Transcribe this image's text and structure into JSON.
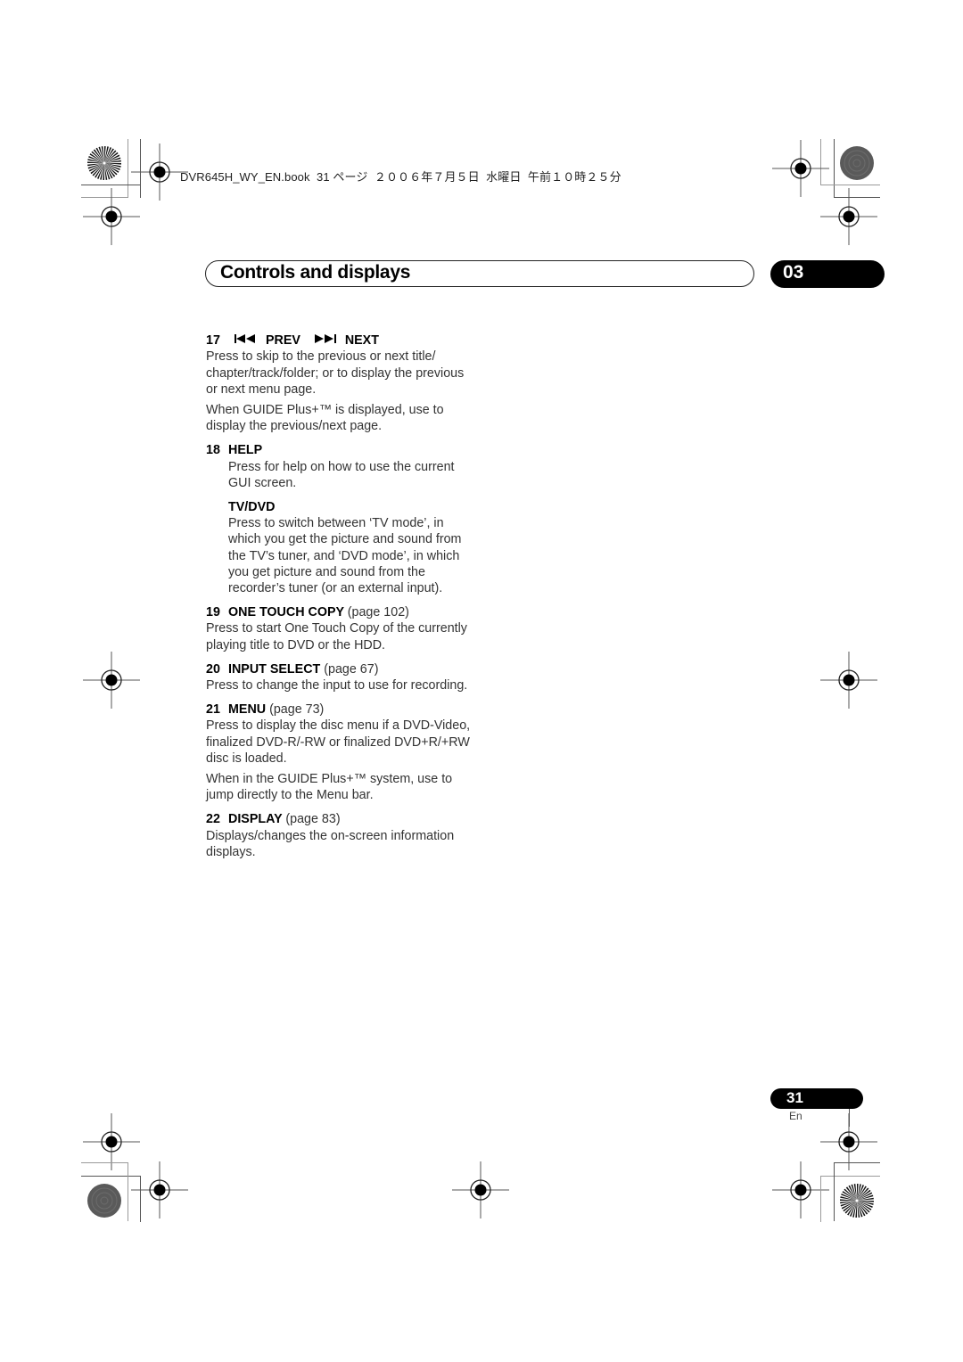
{
  "slug": {
    "text": "DVR645H_WY_EN.book  31 ページ  ２００６年７月５日  水曜日  午前１０時２５分"
  },
  "chapter": {
    "title": "Controls and displays",
    "number": "03"
  },
  "entries": [
    {
      "num": "17",
      "prev_icon": "skip-previous-icon",
      "label_prev": "PREV",
      "next_icon": "skip-next-icon",
      "label_next": "NEXT",
      "paragraphs": [
        "Press to skip to the previous or next title/ chapter/track/folder; or to display the previous or next menu page.",
        "When GUIDE Plus+™ is displayed, use to display the previous/next page."
      ]
    },
    {
      "num": "18",
      "label": "HELP",
      "paragraphs": [
        "Press for help on how to use the current GUI screen."
      ],
      "sub": {
        "label": "TV/DVD",
        "paragraphs": [
          "Press to switch between ‘TV mode’, in which you get the picture and sound from the TV’s tuner, and ‘DVD mode’, in which you get picture and sound from the recorder’s tuner (or an external input)."
        ]
      }
    },
    {
      "num": "19",
      "label": "ONE TOUCH COPY",
      "pageref": "(page 102)",
      "paragraphs": [
        "Press to start One Touch Copy of the currently playing title to DVD or the HDD."
      ]
    },
    {
      "num": "20",
      "label": "INPUT SELECT",
      "pageref": "(page 67)",
      "paragraphs": [
        "Press to change the input to use for recording."
      ]
    },
    {
      "num": "21",
      "label": "MENU",
      "pageref": "(page 73)",
      "paragraphs": [
        "Press to display the disc menu if a DVD-Video, finalized DVD-R/-RW or finalized DVD+R/+RW disc is loaded.",
        "When in the GUIDE Plus+™ system, use to jump directly to the Menu bar."
      ]
    },
    {
      "num": "22",
      "label": "DISPLAY",
      "pageref": "(page 83)",
      "paragraphs": [
        "Displays/changes the on-screen information displays."
      ]
    }
  ],
  "footer": {
    "page_number": "31",
    "language": "En"
  }
}
